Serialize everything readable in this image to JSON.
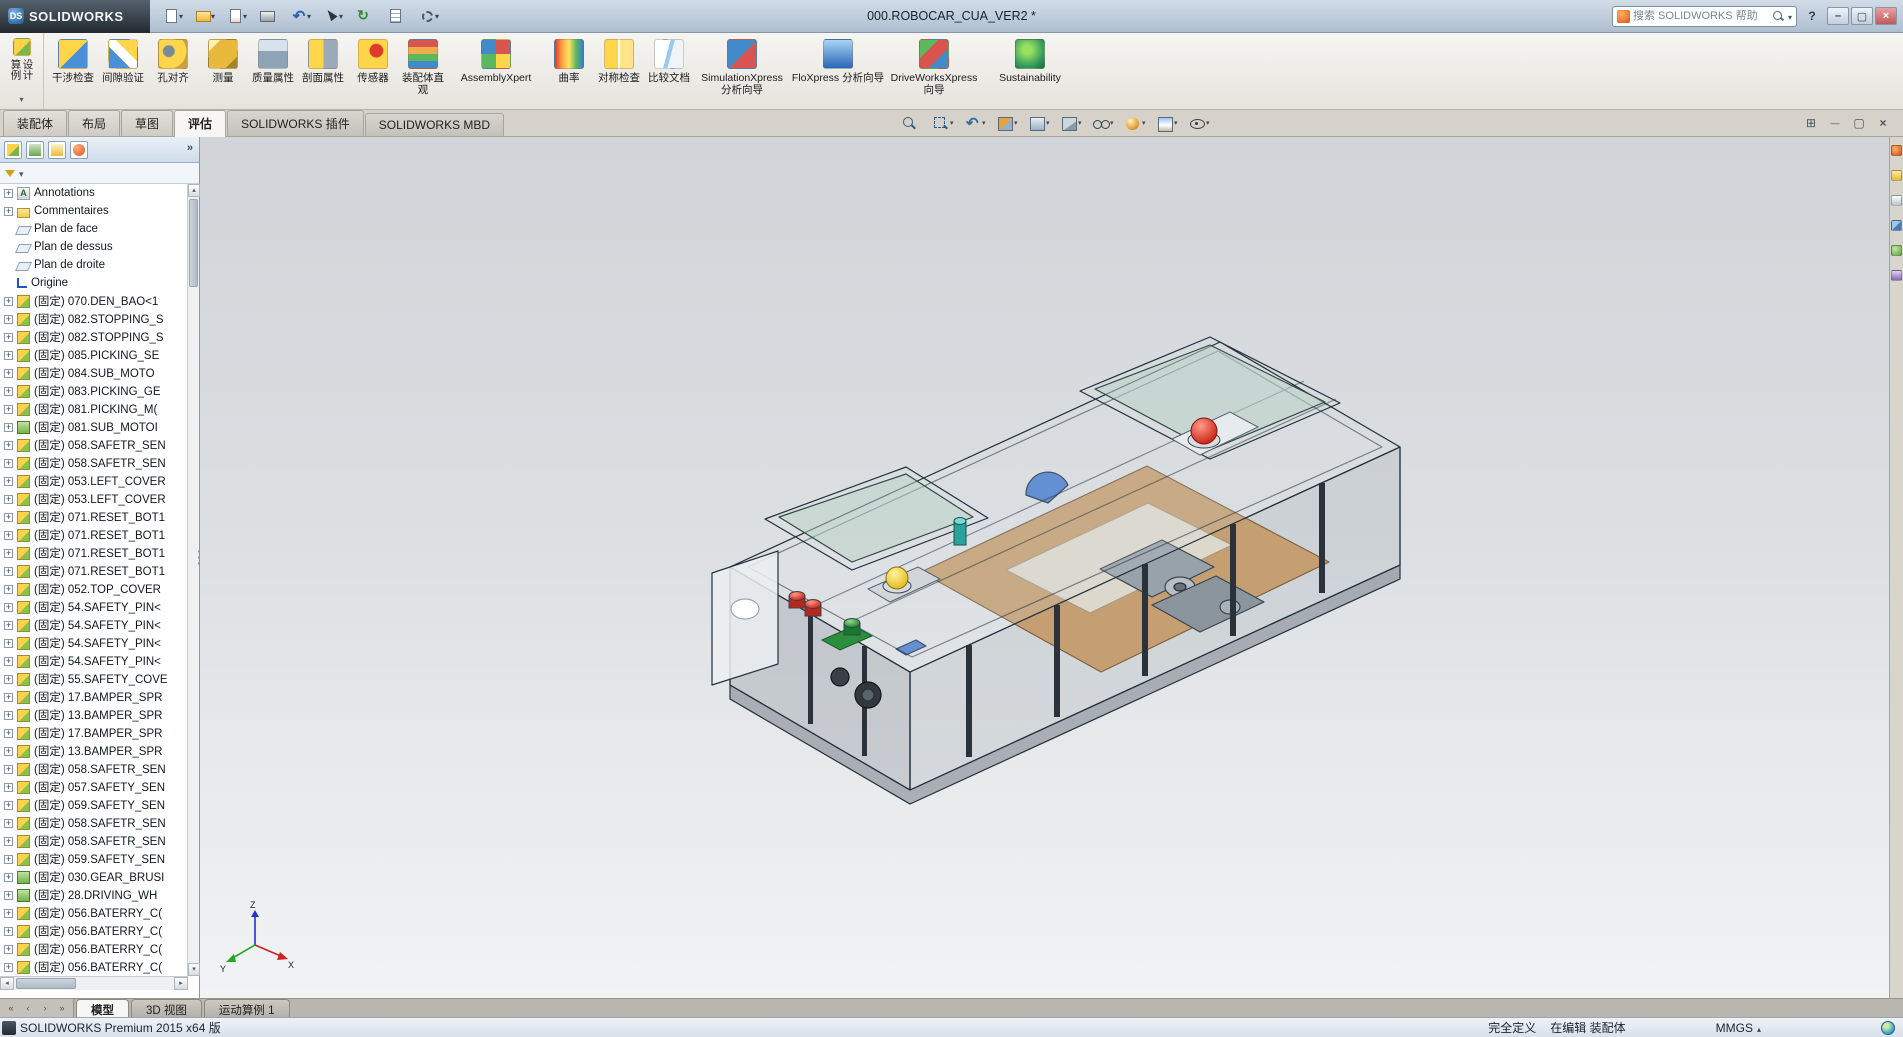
{
  "titlebar": {
    "brand": "SOLIDWORKS",
    "brand_mark": "DS",
    "title": "000.ROBOCAR_CUA_VER2 *",
    "search": {
      "placeholder": "搜索 SOLIDWORKS 帮助"
    },
    "help_glyph": "?",
    "quick_tools": [
      {
        "icon": "new-file-icon",
        "caret": "caret"
      },
      {
        "icon": "open-file-icon",
        "caret": "caret"
      },
      {
        "icon": "publish-icon",
        "caret": "caret"
      },
      {
        "icon": "print-icon",
        "caret": ""
      },
      {
        "icon": "undo-icon",
        "caret": "caret"
      },
      {
        "icon": "select-arrow-icon",
        "caret": "caret"
      },
      {
        "icon": "rebuild-icon",
        "caret": ""
      },
      {
        "icon": "file-properties-icon",
        "caret": ""
      },
      {
        "icon": "options-icon",
        "caret": "caret"
      }
    ],
    "window_controls": [
      {
        "icon": "minimize-icon"
      },
      {
        "icon": "maximize-icon"
      },
      {
        "icon": "close-icon"
      }
    ]
  },
  "ribbon": {
    "design_study": {
      "label": "设计算例"
    },
    "buttons": [
      {
        "label": "干涉检查",
        "icon": "interference-check-icon",
        "size": "",
        "sep": ""
      },
      {
        "label": "间隙验证",
        "icon": "clearance-verify-icon",
        "size": "",
        "sep": ""
      },
      {
        "label": "孔对齐",
        "icon": "hole-alignment-icon",
        "size": "",
        "sep": ""
      },
      {
        "label": "测量",
        "icon": "measure-icon",
        "size": "",
        "sep": ""
      },
      {
        "label": "质量属性",
        "icon": "mass-properties-icon",
        "size": "",
        "sep": ""
      },
      {
        "label": "剖面属性",
        "icon": "section-properties-icon",
        "size": "",
        "sep": ""
      },
      {
        "label": "传感器",
        "icon": "sensor-icon",
        "size": "",
        "sep": ""
      },
      {
        "label": "装配体直观",
        "icon": "assembly-visualization-icon",
        "size": "",
        "sep": ""
      },
      {
        "label": "AssemblyXpert",
        "icon": "assemblyxpert-icon",
        "size": "wide",
        "sep": ""
      },
      {
        "label": "曲率",
        "icon": "curvature-icon",
        "size": "",
        "sep": ""
      },
      {
        "label": "对称检查",
        "icon": "symmetry-check-icon",
        "size": "",
        "sep": ""
      },
      {
        "label": "比较文档",
        "icon": "compare-documents-icon",
        "size": "",
        "sep": "sep"
      },
      {
        "label": "SimulationXpress 分析向导",
        "icon": "simulationxpress-icon",
        "size": "wide",
        "sep": "sep"
      },
      {
        "label": "FloXpress 分析向导",
        "icon": "floxpress-icon",
        "size": "wide",
        "sep": ""
      },
      {
        "label": "DriveWorksXpress 向导",
        "icon": "driveworksxpress-icon",
        "size": "wide",
        "sep": ""
      },
      {
        "label": "Sustainability",
        "icon": "sustainability-icon",
        "size": "wide",
        "sep": ""
      }
    ]
  },
  "tabrow": {
    "tabs": [
      {
        "label": "装配体",
        "state": ""
      },
      {
        "label": "布局",
        "state": ""
      },
      {
        "label": "草图",
        "state": ""
      },
      {
        "label": "评估",
        "state": "active"
      },
      {
        "label": "SOLIDWORKS 插件",
        "state": "addin"
      },
      {
        "label": "SOLIDWORKS MBD",
        "state": "addin"
      }
    ],
    "hud": [
      {
        "icon": "zoom-fit-icon",
        "caret": ""
      },
      {
        "icon": "zoom-area-icon",
        "caret": "caret"
      },
      {
        "icon": "previous-view-icon",
        "caret": "caret"
      },
      {
        "icon": "section-view-icon",
        "caret": "caret"
      },
      {
        "icon": "view-orientation-icon",
        "caret": "caret"
      },
      {
        "icon": "display-style-icon",
        "caret": "caret"
      },
      {
        "icon": "hide-show-icon",
        "caret": "caret"
      },
      {
        "icon": "edit-appearance-icon",
        "caret": "caret"
      },
      {
        "icon": "apply-scene-icon",
        "caret": "caret"
      },
      {
        "icon": "view-settings-icon",
        "caret": "caret"
      }
    ],
    "doc_controls": [
      {
        "icon": "doc-new-window-icon"
      },
      {
        "icon": "doc-minimize-icon"
      },
      {
        "icon": "doc-restore-icon"
      },
      {
        "icon": "doc-close-icon"
      }
    ]
  },
  "panel": {
    "fm_tabs": [
      {
        "icon": "featuremanager-tree-icon"
      },
      {
        "icon": "propertymanager-icon"
      },
      {
        "icon": "configurationmanager-icon"
      },
      {
        "icon": "dimxpertmanager-icon"
      }
    ],
    "tree_items": [
      {
        "label": "Annotations",
        "type": "annotations",
        "exp": "plus"
      },
      {
        "label": "Commentaires",
        "type": "folder",
        "exp": "plus"
      },
      {
        "label": "Plan de face",
        "type": "plane",
        "exp": "none"
      },
      {
        "label": "Plan de dessus",
        "type": "plane",
        "exp": "none"
      },
      {
        "label": "Plan de droite",
        "type": "plane",
        "exp": "none"
      },
      {
        "label": "Origine",
        "type": "origin",
        "exp": "none"
      },
      {
        "label": "(固定) 070.DEN_BAO<1",
        "type": "component",
        "exp": "plus"
      },
      {
        "label": "(固定) 082.STOPPING_S",
        "type": "component",
        "exp": "plus"
      },
      {
        "label": "(固定) 082.STOPPING_S",
        "type": "component",
        "exp": "plus"
      },
      {
        "label": "(固定) 085.PICKING_SE",
        "type": "component",
        "exp": "plus"
      },
      {
        "label": "(固定) 084.SUB_MOTO",
        "type": "component",
        "exp": "plus"
      },
      {
        "label": "(固定) 083.PICKING_GE",
        "type": "component",
        "exp": "plus"
      },
      {
        "label": "(固定) 081.PICKING_M(",
        "type": "component",
        "exp": "plus"
      },
      {
        "label": "(固定) 081.SUB_MOTOI",
        "type": "part",
        "exp": "plus"
      },
      {
        "label": "(固定) 058.SAFETR_SEN",
        "type": "component",
        "exp": "plus"
      },
      {
        "label": "(固定) 058.SAFETR_SEN",
        "type": "component",
        "exp": "plus"
      },
      {
        "label": "(固定) 053.LEFT_COVER",
        "type": "component",
        "exp": "plus"
      },
      {
        "label": "(固定) 053.LEFT_COVER",
        "type": "component",
        "exp": "plus"
      },
      {
        "label": "(固定) 071.RESET_BOT1",
        "type": "component",
        "exp": "plus"
      },
      {
        "label": "(固定) 071.RESET_BOT1",
        "type": "component",
        "exp": "plus"
      },
      {
        "label": "(固定) 071.RESET_BOT1",
        "type": "component",
        "exp": "plus"
      },
      {
        "label": "(固定) 071.RESET_BOT1",
        "type": "component",
        "exp": "plus"
      },
      {
        "label": "(固定) 052.TOP_COVER",
        "type": "component",
        "exp": "plus"
      },
      {
        "label": "(固定) 54.SAFETY_PIN<",
        "type": "component",
        "exp": "plus"
      },
      {
        "label": "(固定) 54.SAFETY_PIN<",
        "type": "component",
        "exp": "plus"
      },
      {
        "label": "(固定) 54.SAFETY_PIN<",
        "type": "component",
        "exp": "plus"
      },
      {
        "label": "(固定) 54.SAFETY_PIN<",
        "type": "component",
        "exp": "plus"
      },
      {
        "label": "(固定) 55.SAFETY_COVE",
        "type": "component",
        "exp": "plus"
      },
      {
        "label": "(固定) 17.BAMPER_SPR",
        "type": "component",
        "exp": "plus"
      },
      {
        "label": "(固定) 13.BAMPER_SPR",
        "type": "component",
        "exp": "plus"
      },
      {
        "label": "(固定) 17.BAMPER_SPR",
        "type": "component",
        "exp": "plus"
      },
      {
        "label": "(固定) 13.BAMPER_SPR",
        "type": "component",
        "exp": "plus"
      },
      {
        "label": "(固定) 058.SAFETR_SEN",
        "type": "component",
        "exp": "plus"
      },
      {
        "label": "(固定) 057.SAFETY_SEN",
        "type": "component",
        "exp": "plus"
      },
      {
        "label": "(固定) 059.SAFETY_SEN",
        "type": "component",
        "exp": "plus"
      },
      {
        "label": "(固定) 058.SAFETR_SEN",
        "type": "component",
        "exp": "plus"
      },
      {
        "label": "(固定) 058.SAFETR_SEN",
        "type": "component",
        "exp": "plus"
      },
      {
        "label": "(固定) 059.SAFETY_SEN",
        "type": "component",
        "exp": "plus"
      },
      {
        "label": "(固定) 030.GEAR_BRUSI",
        "type": "part",
        "exp": "plus"
      },
      {
        "label": "(固定) 28.DRIVING_WH",
        "type": "part",
        "exp": "plus"
      },
      {
        "label": "(固定) 056.BATERRY_C(",
        "type": "component",
        "exp": "plus"
      },
      {
        "label": "(固定) 056.BATERRY_C(",
        "type": "component",
        "exp": "plus"
      },
      {
        "label": "(固定) 056.BATERRY_C(",
        "type": "component",
        "exp": "plus"
      },
      {
        "label": "(固定) 056.BATERRY_C(",
        "type": "component",
        "exp": "plus"
      }
    ]
  },
  "viewport": {
    "triad": {
      "x": "X",
      "y": "Y",
      "z": "Z"
    }
  },
  "task_pane": [
    {
      "icon": "solidworks-resources-icon"
    },
    {
      "icon": "design-library-icon"
    },
    {
      "icon": "file-explorer-icon"
    },
    {
      "icon": "view-palette-icon"
    },
    {
      "icon": "appearances-scenes-icon"
    },
    {
      "icon": "custom-properties-icon"
    }
  ],
  "bottom_tabs": {
    "nav": [
      {
        "icon": "first-tab-icon"
      },
      {
        "icon": "prev-tab-icon"
      },
      {
        "icon": "next-tab-icon"
      },
      {
        "icon": "last-tab-icon"
      }
    ],
    "tabs": [
      {
        "label": "模型",
        "state": "active"
      },
      {
        "label": "3D 视图",
        "state": ""
      },
      {
        "label": "运动算例 1",
        "state": ""
      }
    ]
  },
  "statusbar": {
    "left": "SOLIDWORKS Premium 2015 x64 版",
    "defined": "完全定义",
    "editing": "在编辑 装配体",
    "units": "MMGS"
  }
}
